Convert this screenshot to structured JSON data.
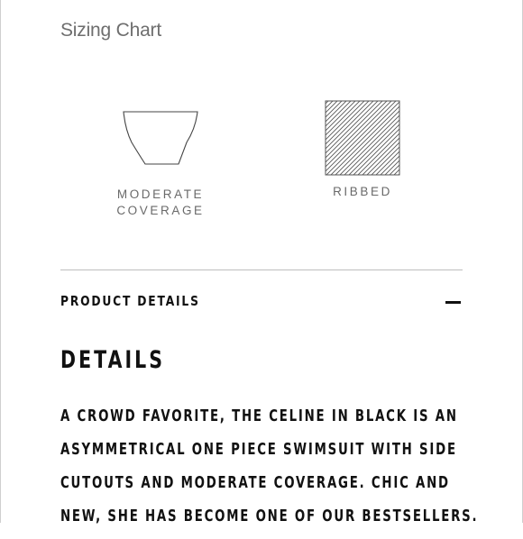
{
  "sizing_chart_link": "Sizing Chart",
  "features": [
    {
      "icon": "coverage-icon",
      "label_lines": [
        "MODERATE",
        "COVERAGE"
      ]
    },
    {
      "icon": "ribbed-fabric-icon",
      "label_lines": [
        "RIBBED"
      ]
    }
  ],
  "product_details": {
    "title": "PRODUCT DETAILS",
    "toggle_icon": "minus-icon",
    "expanded": true
  },
  "details": {
    "heading": "DETAILS",
    "lines": [
      "A CROWD FAVORITE, THE CELINE IN BLACK IS AN",
      "ASYMMETRICAL ONE PIECE SWIMSUIT WITH SIDE",
      "CUTOUTS AND MODERATE COVERAGE. CHIC AND",
      "NEW, SHE HAS BECOME ONE OF OUR BESTSELLERS."
    ]
  },
  "colors": {
    "text": "#111111",
    "muted": "#6e6e6e",
    "divider": "#bdbdbd"
  }
}
